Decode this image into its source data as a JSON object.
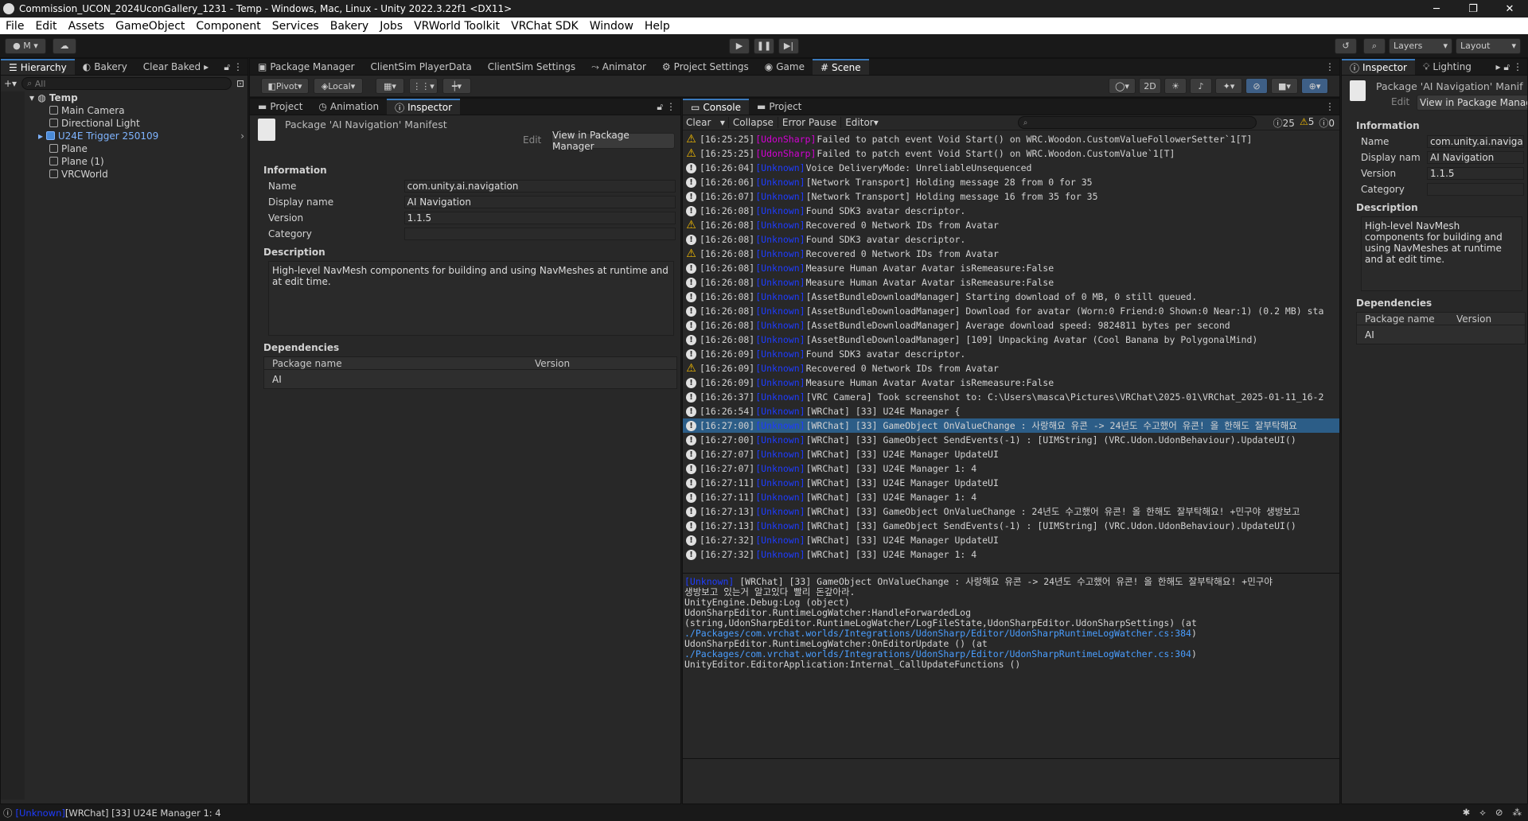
{
  "window_title": "Commission_UCON_2024UconGallery_1231 - Temp - Windows, Mac, Linux - Unity 2022.3.22f1 <DX11>",
  "window_controls": {
    "minimize": "─",
    "maximize": "❐",
    "close": "✕"
  },
  "menu": [
    "File",
    "Edit",
    "Assets",
    "GameObject",
    "Component",
    "Services",
    "Bakery",
    "Jobs",
    "VRWorld Toolkit",
    "VRChat SDK",
    "Window",
    "Help"
  ],
  "toolbar": {
    "account": "M",
    "layers": "Layers",
    "layout": "Layout"
  },
  "hierarchy": {
    "tabs": [
      "Hierarchy",
      "Bakery",
      "Clear Baked"
    ],
    "search_placeholder": "All",
    "scene": "Temp",
    "items": [
      "Main Camera",
      "Directional Light",
      "U24E Trigger 250109",
      "Plane",
      "Plane (1)",
      "VRCWorld"
    ]
  },
  "center_top_tabs": [
    "Package Manager",
    "ClientSim PlayerData",
    "ClientSim Settings",
    "Animator",
    "Project Settings",
    "Game",
    "Scene"
  ],
  "scene_toolbar": {
    "pivot": "Pivot",
    "local": "Local",
    "mode_2d": "2D"
  },
  "left_inspector": {
    "tabs": [
      "Project",
      "Animation",
      "Inspector"
    ],
    "header_title": "Package 'AI Navigation' Manifest",
    "edit_label": "Edit",
    "view_button": "View in Package Manager",
    "information_label": "Information",
    "fields": [
      {
        "label": "Name",
        "value": "com.unity.ai.navigation"
      },
      {
        "label": "Display name",
        "value": "AI Navigation"
      },
      {
        "label": "Version",
        "value": "1.1.5"
      },
      {
        "label": "Category",
        "value": ""
      }
    ],
    "description_label": "Description",
    "description": "High-level NavMesh components for building and using NavMeshes at runtime and at edit time.",
    "dependencies_label": "Dependencies",
    "dep_cols": [
      "Package name",
      "Version"
    ],
    "dep_rows": [
      {
        "name": "AI",
        "version": ""
      }
    ]
  },
  "console": {
    "tabs": [
      "Console",
      "Project"
    ],
    "buttons": {
      "clear": "Clear",
      "collapse": "Collapse",
      "error_pause": "Error Pause",
      "editor": "Editor"
    },
    "counts": {
      "info": "25",
      "warn": "5",
      "error": "0"
    },
    "rows": [
      {
        "type": "warn",
        "time": "[16:25:25]",
        "tag": "[UdonSharp]",
        "tagc": "us",
        "msg": " Failed to patch event Void Start() on WRC.Woodon.CustomValueFollowerSetter`1[T]"
      },
      {
        "type": "warn",
        "time": "[16:25:25]",
        "tag": "[UdonSharp]",
        "tagc": "us",
        "msg": " Failed to patch event Void Start() on WRC.Woodon.CustomValue`1[T]"
      },
      {
        "type": "info",
        "time": "[16:26:04]",
        "tag": "[Unknown]",
        "tagc": "un",
        "msg": " Voice DeliveryMode: UnreliableUnsequenced"
      },
      {
        "type": "info",
        "time": "[16:26:06]",
        "tag": "[Unknown]",
        "tagc": "un",
        "msg": " [Network Transport] Holding message 28 from 0 for 35"
      },
      {
        "type": "info",
        "time": "[16:26:07]",
        "tag": "[Unknown]",
        "tagc": "un",
        "msg": " [Network Transport] Holding message 16 from 35 for 35"
      },
      {
        "type": "info",
        "time": "[16:26:08]",
        "tag": "[Unknown]",
        "tagc": "un",
        "msg": " Found SDK3 avatar descriptor."
      },
      {
        "type": "warn",
        "time": "[16:26:08]",
        "tag": "[Unknown]",
        "tagc": "un",
        "msg": " Recovered 0 Network IDs from Avatar"
      },
      {
        "type": "info",
        "time": "[16:26:08]",
        "tag": "[Unknown]",
        "tagc": "un",
        "msg": " Found SDK3 avatar descriptor."
      },
      {
        "type": "warn",
        "time": "[16:26:08]",
        "tag": "[Unknown]",
        "tagc": "un",
        "msg": " Recovered 0 Network IDs from Avatar"
      },
      {
        "type": "info",
        "time": "[16:26:08]",
        "tag": "[Unknown]",
        "tagc": "un",
        "msg": " Measure Human Avatar Avatar isRemeasure:False"
      },
      {
        "type": "info",
        "time": "[16:26:08]",
        "tag": "[Unknown]",
        "tagc": "un",
        "msg": " Measure Human Avatar Avatar isRemeasure:False"
      },
      {
        "type": "info",
        "time": "[16:26:08]",
        "tag": "[Unknown]",
        "tagc": "un",
        "msg": " [AssetBundleDownloadManager] Starting download of 0 MB, 0 still queued."
      },
      {
        "type": "info",
        "time": "[16:26:08]",
        "tag": "[Unknown]",
        "tagc": "un",
        "msg": " [AssetBundleDownloadManager] Download for avatar (Worn:0 Friend:0 Shown:0 Near:1) (0.2 MB) sta"
      },
      {
        "type": "info",
        "time": "[16:26:08]",
        "tag": "[Unknown]",
        "tagc": "un",
        "msg": " [AssetBundleDownloadManager] Average download speed: 9824811 bytes per second"
      },
      {
        "type": "info",
        "time": "[16:26:08]",
        "tag": "[Unknown]",
        "tagc": "un",
        "msg": " [AssetBundleDownloadManager] [109] Unpacking Avatar (Cool Banana by PolygonalMind)"
      },
      {
        "type": "info",
        "time": "[16:26:09]",
        "tag": "[Unknown]",
        "tagc": "un",
        "msg": " Found SDK3 avatar descriptor."
      },
      {
        "type": "warn",
        "time": "[16:26:09]",
        "tag": "[Unknown]",
        "tagc": "un",
        "msg": " Recovered 0 Network IDs from Avatar"
      },
      {
        "type": "info",
        "time": "[16:26:09]",
        "tag": "[Unknown]",
        "tagc": "un",
        "msg": " Measure Human Avatar Avatar isRemeasure:False"
      },
      {
        "type": "info",
        "time": "[16:26:37]",
        "tag": "[Unknown]",
        "tagc": "un",
        "msg": " [VRC Camera] Took screenshot to: C:\\Users\\masca\\Pictures\\VRChat\\2025-01\\VRChat_2025-01-11_16-2"
      },
      {
        "type": "info",
        "time": "[16:26:54]",
        "tag": "[Unknown]",
        "tagc": "un",
        "msg": " [WRChat] [33] U24E Manager {"
      },
      {
        "type": "info",
        "time": "[16:27:00]",
        "tag": "[Unknown]",
        "tagc": "un",
        "msg": " [WRChat] [33] GameObject OnValueChange : 사랑해요 유콘 -> 24년도 수고했어 유콘! 올 한해도 잘부탁해요",
        "sel": true
      },
      {
        "type": "info",
        "time": "[16:27:00]",
        "tag": "[Unknown]",
        "tagc": "un",
        "msg": " [WRChat] [33] GameObject SendEvents(-1) : [UIMString] (VRC.Udon.UdonBehaviour).UpdateUI()"
      },
      {
        "type": "info",
        "time": "[16:27:07]",
        "tag": "[Unknown]",
        "tagc": "un",
        "msg": " [WRChat] [33] U24E Manager UpdateUI"
      },
      {
        "type": "info",
        "time": "[16:27:07]",
        "tag": "[Unknown]",
        "tagc": "un",
        "msg": " [WRChat] [33] U24E Manager 1: 4"
      },
      {
        "type": "info",
        "time": "[16:27:11]",
        "tag": "[Unknown]",
        "tagc": "un",
        "msg": " [WRChat] [33] U24E Manager UpdateUI"
      },
      {
        "type": "info",
        "time": "[16:27:11]",
        "tag": "[Unknown]",
        "tagc": "un",
        "msg": " [WRChat] [33] U24E Manager 1: 4"
      },
      {
        "type": "info",
        "time": "[16:27:13]",
        "tag": "[Unknown]",
        "tagc": "un",
        "msg": " [WRChat] [33] GameObject OnValueChange : 24년도 수고했어 유콘! 올 한해도 잘부탁해요! +민구야 생방보고"
      },
      {
        "type": "info",
        "time": "[16:27:13]",
        "tag": "[Unknown]",
        "tagc": "un",
        "msg": " [WRChat] [33] GameObject SendEvents(-1) : [UIMString] (VRC.Udon.UdonBehaviour).UpdateUI()"
      },
      {
        "type": "info",
        "time": "[16:27:32]",
        "tag": "[Unknown]",
        "tagc": "un",
        "msg": " [WRChat] [33] U24E Manager UpdateUI"
      },
      {
        "type": "info",
        "time": "[16:27:32]",
        "tag": "[Unknown]",
        "tagc": "un",
        "msg": " [WRChat] [33] U24E Manager 1: 4"
      }
    ],
    "detail": {
      "l1_tag": "[Unknown]",
      "l1": " [WRChat] [33] GameObject OnValueChange : 사랑해요 유콘 -> 24년도 수고했어 유콘! 올 한해도 잘부탁해요! +민구야",
      "l2": "생방보고 있는거 알고있다 빨리 돈갚아라.",
      "l3": "UnityEngine.Debug:Log (object)",
      "l4": "UdonSharpEditor.RuntimeLogWatcher:HandleForwardedLog",
      "l5": "(string,UdonSharpEditor.RuntimeLogWatcher/LogFileState,UdonSharpEditor.UdonSharpSettings) (at",
      "l6_link": "./Packages/com.vrchat.worlds/Integrations/UdonSharp/Editor/UdonSharpRuntimeLogWatcher.cs:384",
      "l6_end": ")",
      "l7": "UdonSharpEditor.RuntimeLogWatcher:OnEditorUpdate () (at",
      "l8_link": "./Packages/com.vrchat.worlds/Integrations/UdonSharp/Editor/UdonSharpRuntimeLogWatcher.cs:304",
      "l8_end": ")",
      "l9": "UnityEditor.EditorApplication:Internal_CallUpdateFunctions ()"
    }
  },
  "right_inspector": {
    "tabs": [
      "Inspector",
      "Lighting"
    ],
    "header_title": "Package 'AI Navigation' Manif",
    "edit_label": "Edit",
    "view_button": "View in Package Manag",
    "information_label": "Information",
    "fields": [
      {
        "label": "Name",
        "value": "com.unity.ai.navigatio"
      },
      {
        "label": "Display nam",
        "value": "AI Navigation"
      },
      {
        "label": "Version",
        "value": "1.1.5"
      },
      {
        "label": "Category",
        "value": ""
      }
    ],
    "description_label": "Description",
    "description": "High-level NavMesh components for building and using NavMeshes at runtime and at edit time.",
    "dependencies_label": "Dependencies",
    "dep_cols": [
      "Package name",
      "Version"
    ],
    "dep_rows": [
      {
        "name": "AI",
        "version": ""
      }
    ]
  },
  "status": {
    "tag": "[Unknown]",
    "msg": " [WRChat] [33] U24E Manager 1: 4"
  },
  "colors": {
    "accent": "#3a79bb",
    "selection": "#2c5d87",
    "udonsharp": "#d400d4",
    "unknown": "#1e3cff",
    "warning": "#f4bc02",
    "link": "#4a9eff"
  }
}
